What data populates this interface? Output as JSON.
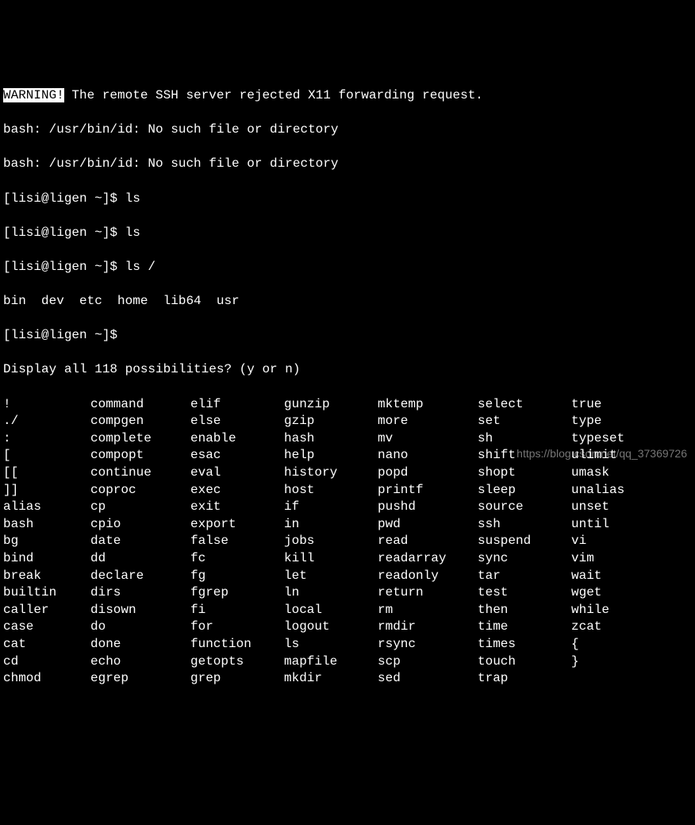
{
  "warning": {
    "label": "WARNING!",
    "message": " The remote SSH server rejected X11 forwarding request."
  },
  "errors": [
    "bash: /usr/bin/id: No such file or directory",
    "bash: /usr/bin/id: No such file or directory"
  ],
  "commands": [
    {
      "prompt": "[lisi@ligen ~]$ ",
      "cmd": "ls"
    },
    {
      "prompt": "[lisi@ligen ~]$ ",
      "cmd": "ls"
    },
    {
      "prompt": "[lisi@ligen ~]$ ",
      "cmd": "ls /"
    }
  ],
  "ls_root_output": "bin  dev  etc  home  lib64  usr",
  "prompt_after": "[lisi@ligen ~]$ ",
  "completion_question": "Display all 118 possibilities? (y or n)",
  "completions": [
    [
      "!",
      "command",
      "elif",
      "gunzip",
      "mktemp",
      "select",
      "true"
    ],
    [
      "./",
      "compgen",
      "else",
      "gzip",
      "more",
      "set",
      "type"
    ],
    [
      ":",
      "complete",
      "enable",
      "hash",
      "mv",
      "sh",
      "typeset"
    ],
    [
      "[",
      "compopt",
      "esac",
      "help",
      "nano",
      "shift",
      "ulimit"
    ],
    [
      "[[",
      "continue",
      "eval",
      "history",
      "popd",
      "shopt",
      "umask"
    ],
    [
      "]]",
      "coproc",
      "exec",
      "host",
      "printf",
      "sleep",
      "unalias"
    ],
    [
      "alias",
      "cp",
      "exit",
      "if",
      "pushd",
      "source",
      "unset"
    ],
    [
      "bash",
      "cpio",
      "export",
      "in",
      "pwd",
      "ssh",
      "until"
    ],
    [
      "bg",
      "date",
      "false",
      "jobs",
      "read",
      "suspend",
      "vi"
    ],
    [
      "bind",
      "dd",
      "fc",
      "kill",
      "readarray",
      "sync",
      "vim"
    ],
    [
      "break",
      "declare",
      "fg",
      "let",
      "readonly",
      "tar",
      "wait"
    ],
    [
      "builtin",
      "dirs",
      "fgrep",
      "ln",
      "return",
      "test",
      "wget"
    ],
    [
      "caller",
      "disown",
      "fi",
      "local",
      "rm",
      "then",
      "while"
    ],
    [
      "case",
      "do",
      "for",
      "logout",
      "rmdir",
      "time",
      "zcat"
    ],
    [
      "cat",
      "done",
      "function",
      "ls",
      "rsync",
      "times",
      "{"
    ],
    [
      "cd",
      "echo",
      "getopts",
      "mapfile",
      "scp",
      "touch",
      "}"
    ],
    [
      "chmod",
      "egrep",
      "grep",
      "mkdir",
      "sed",
      "trap",
      ""
    ]
  ],
  "watermark": "https://blog.csdn.net/qq_37369726"
}
